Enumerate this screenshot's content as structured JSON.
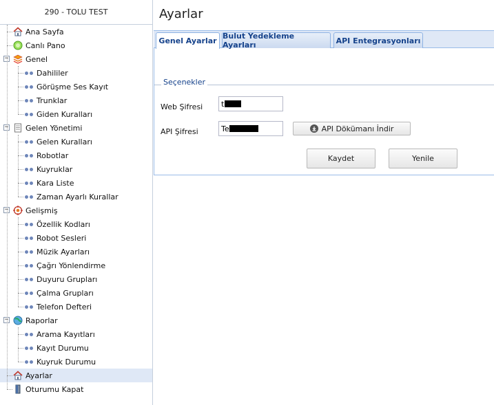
{
  "sidebar": {
    "header": "290 - TOLU TEST",
    "items": [
      {
        "label": "Ana Sayfa",
        "icon": "home-icon"
      },
      {
        "label": "Canlı Pano",
        "icon": "live-board-icon"
      },
      {
        "label": "Genel",
        "icon": "layers-icon",
        "expanded": true,
        "children": [
          "Dahililer",
          "Görüşme Ses Kayıt",
          "Trunklar",
          "Giden Kuralları"
        ]
      },
      {
        "label": "Gelen Yönetimi",
        "icon": "document-icon",
        "expanded": true,
        "children": [
          "Gelen Kuralları",
          "Robotlar",
          "Kuyruklar",
          "Kara Liste",
          "Zaman Ayarlı Kurallar"
        ]
      },
      {
        "label": "Gelişmiş",
        "icon": "target-icon",
        "expanded": true,
        "children": [
          "Özellik Kodları",
          "Robot Sesleri",
          "Müzik Ayarları",
          "Çağrı Yönlendirme",
          "Duyuru Grupları",
          "Çalma Grupları",
          "Telefon Defteri"
        ]
      },
      {
        "label": "Raporlar",
        "icon": "globe-icon",
        "expanded": true,
        "children": [
          "Arama Kayıtları",
          "Kayıt Durumu",
          "Kuyruk Durumu"
        ]
      },
      {
        "label": "Ayarlar",
        "icon": "settings-home-icon",
        "selected": true
      },
      {
        "label": "Oturumu Kapat",
        "icon": "logout-icon"
      }
    ]
  },
  "main": {
    "title": "Ayarlar",
    "tabs": [
      {
        "label": "Genel Ayarlar",
        "active": true
      },
      {
        "label": "Bulut Yedekleme Ayarları",
        "active": false
      },
      {
        "label": "API Entegrasyonları",
        "active": false
      }
    ],
    "options": {
      "legend": "Seçenekler",
      "web_password_label": "Web Şifresi",
      "web_password_value": "t",
      "api_password_label": "API Şifresi",
      "api_password_value": "Te",
      "api_doc_button": "API Dökümanı İndir",
      "save_button": "Kaydet",
      "refresh_button": "Yenile"
    }
  },
  "colors": {
    "tab_text": "#15428b",
    "selected_row": "#dfe8f6",
    "tree_bullet": "#6e86b9"
  }
}
